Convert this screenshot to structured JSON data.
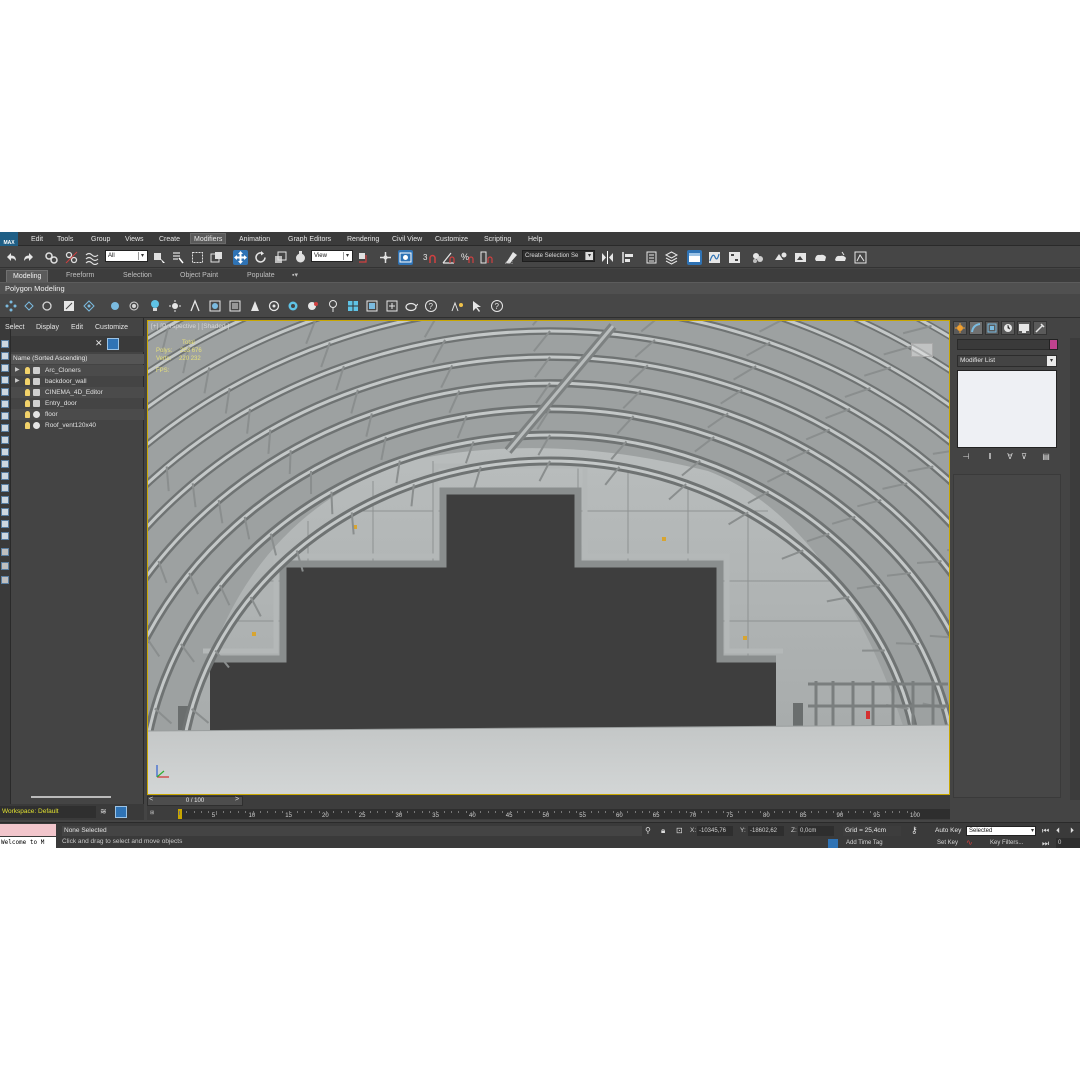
{
  "app": {
    "logo": "MAX"
  },
  "menu": [
    "Edit",
    "Tools",
    "Group",
    "Views",
    "Create",
    "Modifiers",
    "Animation",
    "Graph Editors",
    "Rendering",
    "Civil View",
    "Customize",
    "Scripting",
    "Help"
  ],
  "menu_active": "Modifiers",
  "toolbar": {
    "filter_dropdown": "All",
    "ref_coord_dropdown": "View",
    "selection_set": "Create Selection Se"
  },
  "ribbon": {
    "tabs": [
      "Modeling",
      "Freeform",
      "Selection",
      "Object Paint",
      "Populate"
    ],
    "active_tab": "Modeling",
    "panel_title": "Polygon Modeling"
  },
  "scene_explorer": {
    "menu": [
      "Select",
      "Display",
      "Edit",
      "Customize"
    ],
    "column_header": "Name (Sorted Ascending)",
    "items": [
      {
        "name": "Arc_Cloners",
        "expandable": true,
        "icon": "group-icon"
      },
      {
        "name": "backdoor_wall",
        "expandable": true,
        "icon": "group-icon"
      },
      {
        "name": "CINEMA_4D_Editor",
        "expandable": false,
        "icon": "helper-icon"
      },
      {
        "name": "Entry_door",
        "expandable": false,
        "icon": "group-icon"
      },
      {
        "name": "floor",
        "expandable": false,
        "icon": "sphere-icon"
      },
      {
        "name": "Roof_vent120x40",
        "expandable": false,
        "icon": "sphere-icon"
      }
    ]
  },
  "viewport": {
    "label": "[+] [Perspective ] [Shaded ]",
    "stats": {
      "total_label": "Total",
      "polys_label": "Polys:",
      "polys_value": "253 676",
      "verts_label": "Verts:",
      "verts_value": "220 232",
      "fps_label": "FPS:"
    },
    "colors": {
      "floor": "#c9cccc",
      "opening": "#3e3e3e",
      "structure": "#a4a8a8",
      "selection_border": "#c8a600"
    }
  },
  "command_panel": {
    "modifier_list": "Modifier List",
    "object_color": "#c0428e"
  },
  "workspace": {
    "label": "Workspace: Default"
  },
  "timeline": {
    "slider": "0 / 100",
    "ticks": [
      "5",
      "10",
      "15",
      "20",
      "25",
      "30",
      "35",
      "40",
      "45",
      "50",
      "55",
      "60",
      "65",
      "70",
      "75",
      "80",
      "85",
      "90",
      "95",
      "100"
    ]
  },
  "status": {
    "listener": "Welcome to M",
    "selection": "None Selected",
    "prompt": "Click and drag to select and move objects",
    "x_label": "X:",
    "x_value": "-10345,76",
    "y_label": "Y:",
    "y_value": "-18602,62",
    "z_label": "Z:",
    "z_value": "0,0cm",
    "grid": "Grid = 25,4cm",
    "auto_key": "Auto Key",
    "key_mode": "Selected",
    "set_key": "Set Key",
    "key_filters": "Key Filters...",
    "add_time_tag": "Add Time Tag",
    "frame": "0"
  }
}
